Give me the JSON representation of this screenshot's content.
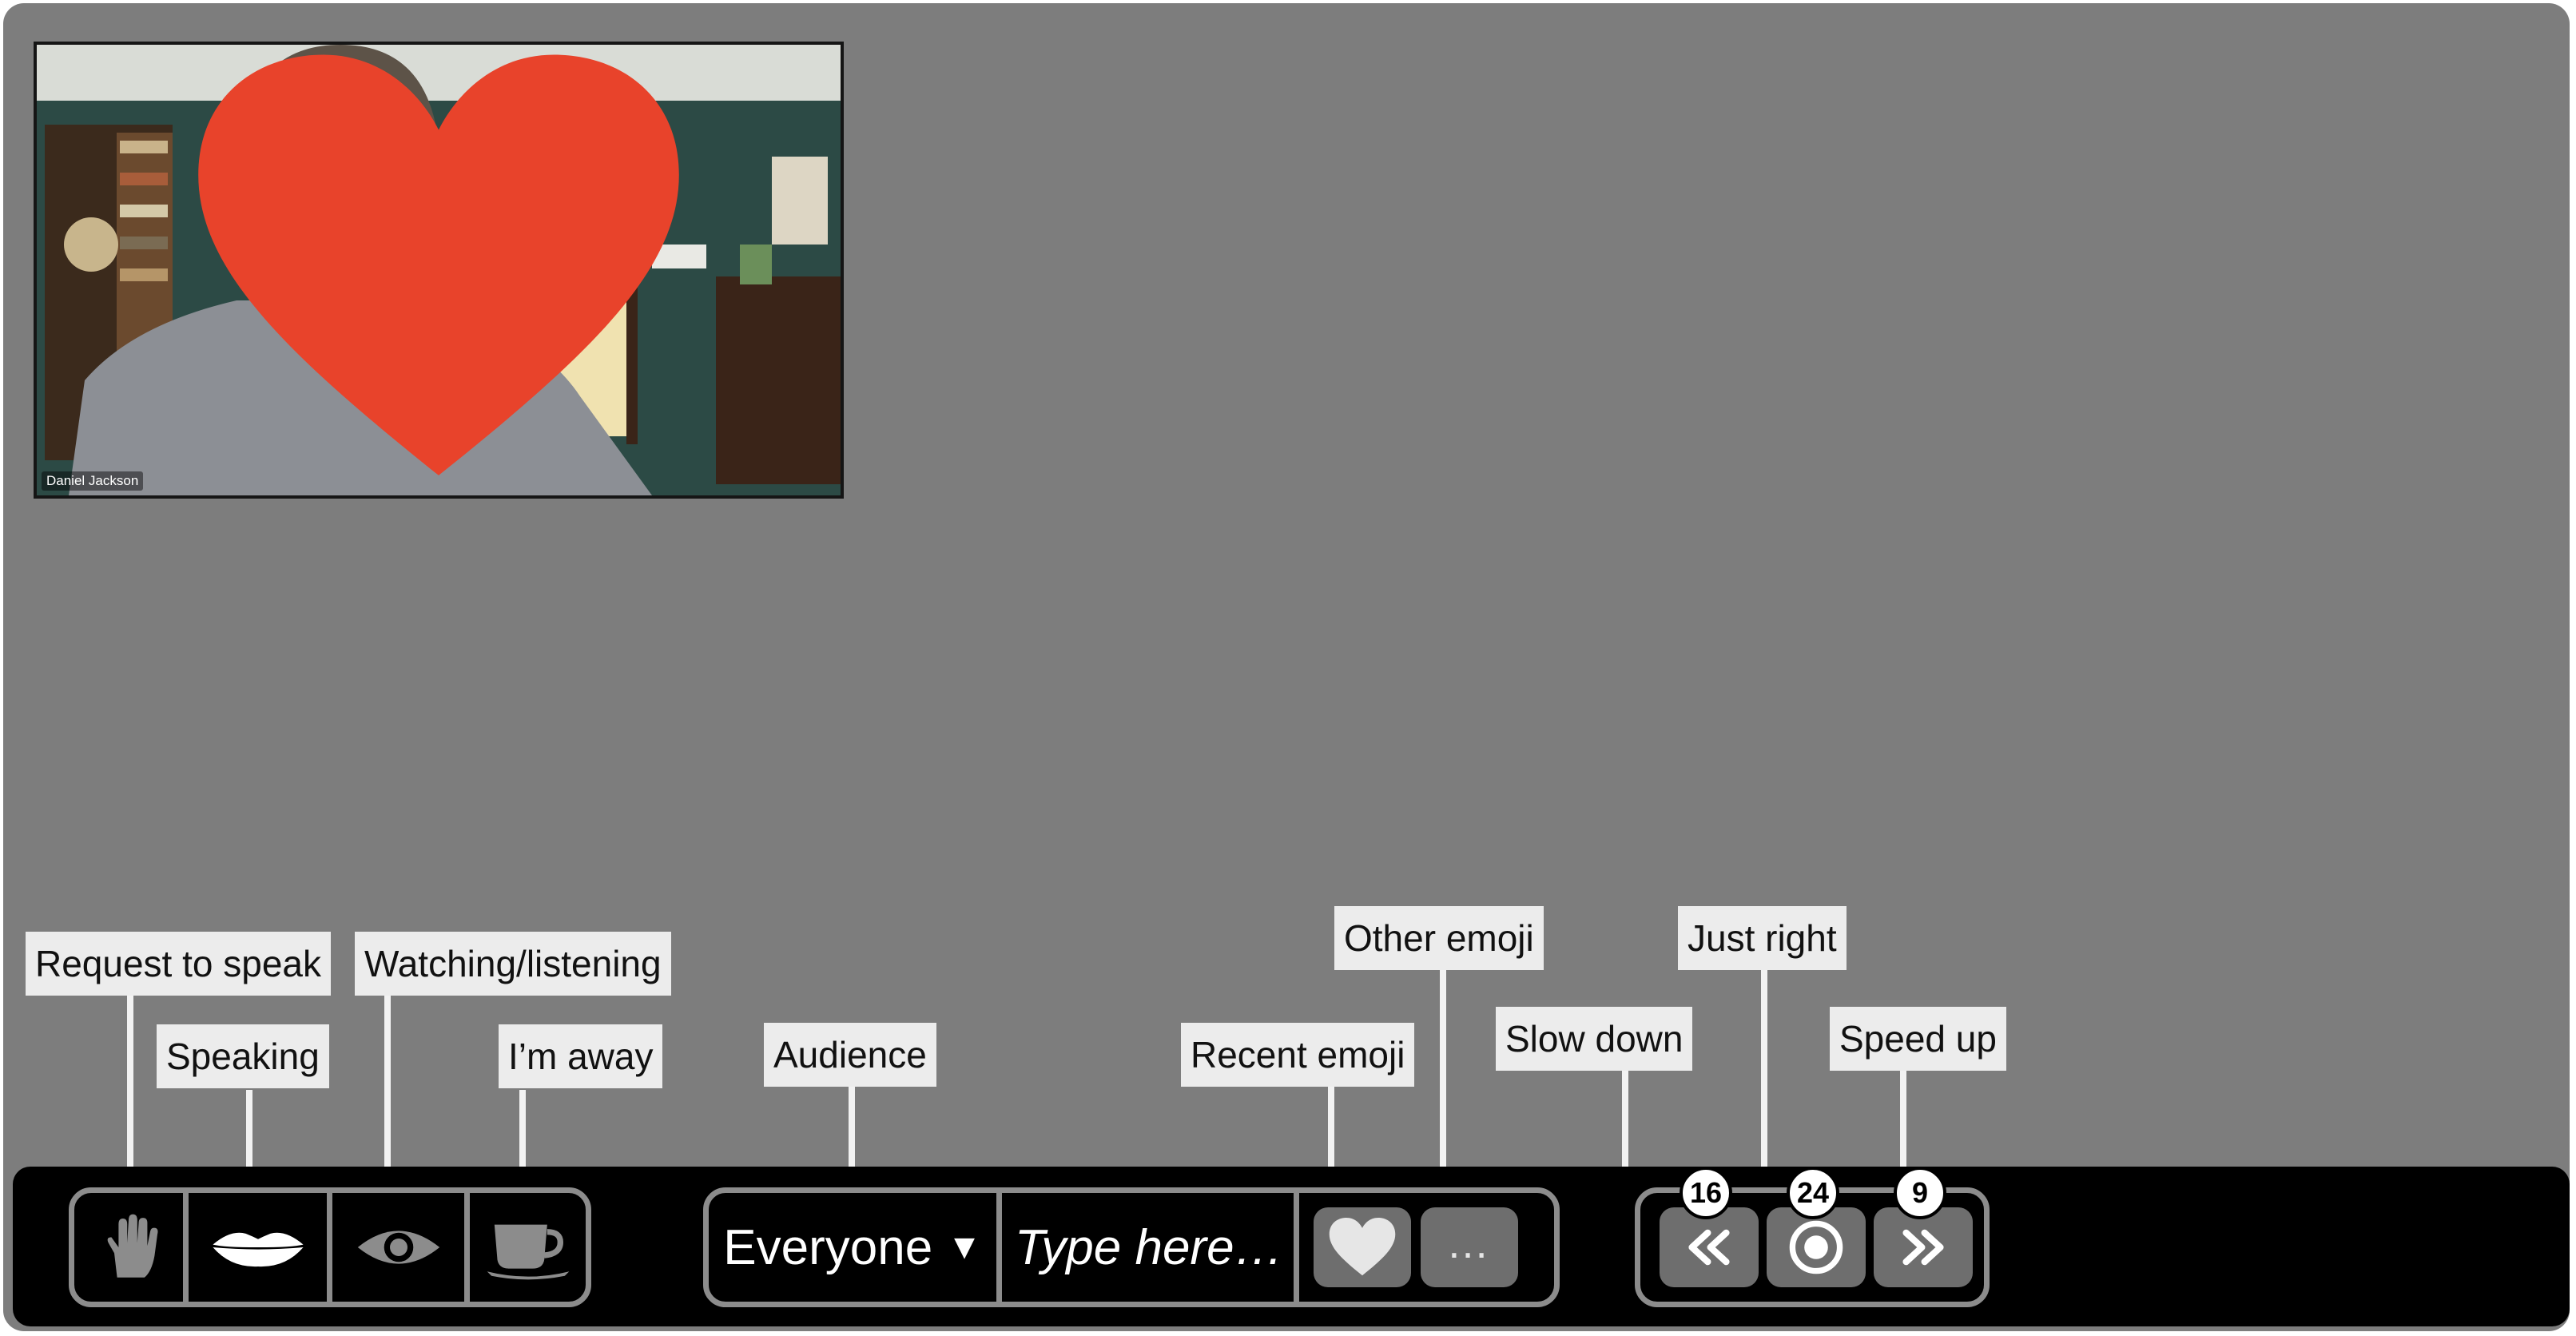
{
  "video": {
    "participant_name": "Daniel Jackson",
    "reaction_icon": "heart-icon",
    "reaction_color": "#e8432b"
  },
  "presence": {
    "hand_icon": "hand-icon",
    "lips_icon": "lips-icon",
    "eye_icon": "eye-icon",
    "cup_icon": "coffee-cup-icon"
  },
  "chat": {
    "audience_value": "Everyone",
    "dropdown_arrow": "▼",
    "input_placeholder": "Type here…",
    "input_value": "",
    "recent_emoji_icon": "heart-icon",
    "other_emoji_label": "…"
  },
  "pace": {
    "slow_icon": "double-chevron-left-icon",
    "right_icon": "target-icon",
    "fast_icon": "double-chevron-right-icon",
    "slow_count": "16",
    "right_count": "24",
    "fast_count": "9"
  },
  "callouts": {
    "request_to_speak": "Request to speak",
    "speaking": "Speaking",
    "watching": "Watching/listening",
    "away": "I’m away",
    "audience": "Audience",
    "recent_emoji": "Recent emoji",
    "other_emoji": "Other emoji",
    "slow_down": "Slow down",
    "just_right": "Just right",
    "speed_up": "Speed up"
  },
  "colors": {
    "stage": "#7d7d7d",
    "bar": "#000000",
    "outline": "#8c8c8c",
    "callout_bg": "#ececec"
  }
}
